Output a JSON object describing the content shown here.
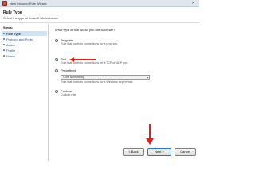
{
  "window": {
    "title": "New Inbound Rule Wizard",
    "close_glyph": "✕"
  },
  "header": {
    "title": "Rule Type",
    "description": "Select the type of firewall rule to create."
  },
  "steps": {
    "heading": "Steps:",
    "items": [
      {
        "label": "Rule Type",
        "active": true
      },
      {
        "label": "Protocol and Ports",
        "active": false
      },
      {
        "label": "Action",
        "active": false
      },
      {
        "label": "Profile",
        "active": false
      },
      {
        "label": "Name",
        "active": false
      }
    ]
  },
  "main": {
    "question": "What type of rule would you like to create?",
    "options": [
      {
        "label": "Program",
        "description": "Rule that controls connections for a program.",
        "selected": false
      },
      {
        "label": "Port",
        "description": "Rule that controls connections for a TCP or UDP port.",
        "selected": true
      },
      {
        "label": "Predefined:",
        "description": "Rule that controls connections for a Windows experience.",
        "selected": false
      },
      {
        "label": "Custom",
        "description": "Custom rule.",
        "selected": false
      }
    ],
    "predefined_select": {
      "value": "Core Networking",
      "arrow": "▾"
    }
  },
  "footer": {
    "back_label": "< Back",
    "next_label": "Next >",
    "cancel_label": "Cancel"
  },
  "colors": {
    "accent": "#1f4fa0",
    "highlight": "#cfe3f8",
    "annotation_red": "#e0201c"
  },
  "icons": [
    "firewall-app-icon",
    "close-icon",
    "dropdown-arrow-icon"
  ]
}
